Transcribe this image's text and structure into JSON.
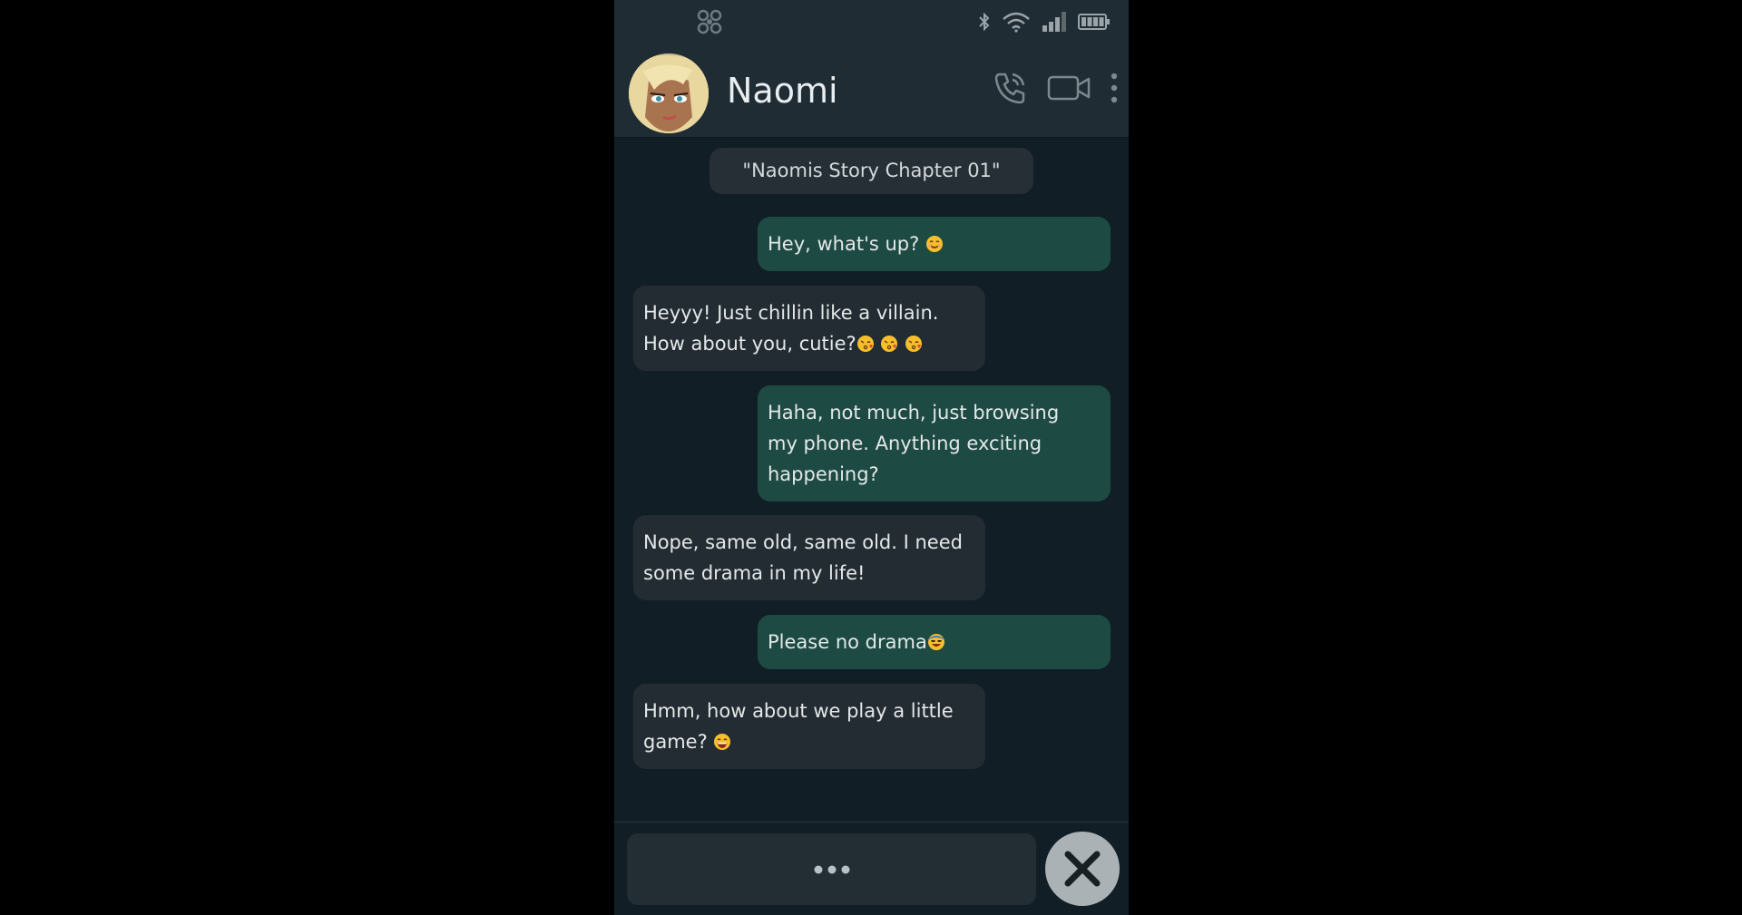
{
  "status_bar": {
    "app_icon": "molecule-icon",
    "icons": [
      "bluetooth-icon",
      "wifi-icon",
      "signal-icon",
      "battery-icon"
    ]
  },
  "header": {
    "contact_name": "Naomi",
    "avatar": "avatar",
    "actions": [
      "phone-call-icon",
      "video-call-icon",
      "more-menu-icon"
    ]
  },
  "chat": {
    "chapter_label": "\"Naomis Story Chapter 01\"",
    "messages": [
      {
        "direction": "out",
        "text": "Hey, what's up? ",
        "emoji": [
          "smiling-face-emoji"
        ]
      },
      {
        "direction": "in",
        "text_line1": "Heyyy! Just chillin like a villain.",
        "text_line2": "How about you, cutie?",
        "emoji": [
          "kissing-face-emoji",
          "kissing-face-emoji",
          "kissing-face-emoji"
        ]
      },
      {
        "direction": "out",
        "text_line1": "Haha, not much, just browsing",
        "text_line2": "my phone. Anything exciting",
        "text_line3": "happening?"
      },
      {
        "direction": "in",
        "text_line1": "Nope, same old, same old. I need",
        "text_line2": "some drama in my life!"
      },
      {
        "direction": "out",
        "text": "Please no drama",
        "emoji": [
          "cool-face-emoji"
        ]
      },
      {
        "direction": "in",
        "text_line1": "Hmm, how about we play a little",
        "text_line2": "game? ",
        "emoji": [
          "grinning-face-emoji"
        ]
      }
    ]
  },
  "footer": {
    "typing_indicator": "typing-dots-icon",
    "close_button": "close-icon"
  },
  "colors": {
    "phone_bg": "#121e25",
    "header_bg": "#1f2c34",
    "bubble_out": "#1d4a42",
    "bubble_in": "#232c32",
    "close_button_bg": "#aab2b6"
  }
}
